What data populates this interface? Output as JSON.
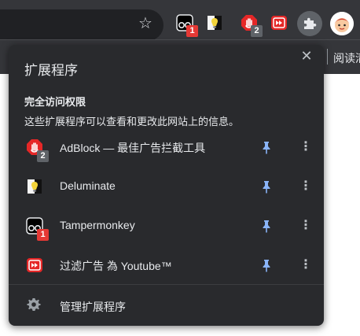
{
  "toolbar": {
    "tampermonkey_badge": "1",
    "adblock_badge": "2"
  },
  "bookmarks_bar": {
    "reading_list_label": "阅读清"
  },
  "popup": {
    "title": "扩展程序",
    "full_access_title": "完全访问权限",
    "full_access_desc": "这些扩展程序可以查看和更改此网站上的信息。",
    "extensions": [
      {
        "name": "AdBlock — 最佳广告拦截工具",
        "badge": "2",
        "icon": "adblock-icon",
        "pinned": true
      },
      {
        "name": "Deluminate",
        "badge": "",
        "icon": "deluminate-icon",
        "pinned": true
      },
      {
        "name": "Tampermonkey",
        "badge": "1",
        "icon": "tampermonkey-icon",
        "pinned": true
      },
      {
        "name": "过滤广告 為 Youtube™",
        "badge": "",
        "icon": "youtube-adblock-icon",
        "pinned": true
      }
    ],
    "manage_label": "管理扩展程序"
  },
  "colors": {
    "toolbar_bg": "#35363a",
    "popup_bg": "#292a2d",
    "pin_blue": "#8ab4f8",
    "badge_red": "#e53935"
  }
}
